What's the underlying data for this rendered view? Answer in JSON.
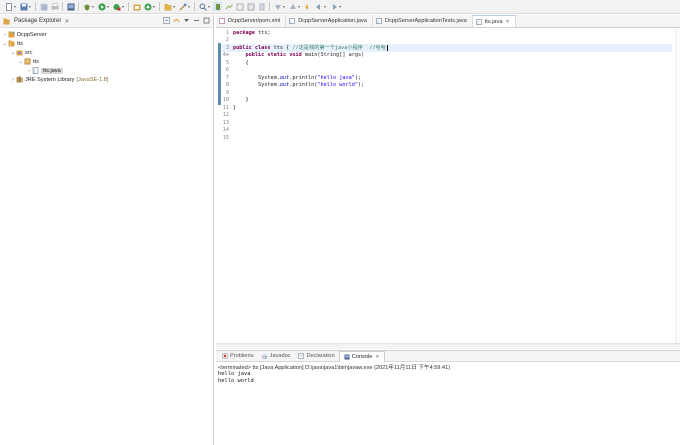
{
  "colors": {
    "keyword": "#7f0055",
    "string": "#2a00ff",
    "comment": "#3f7f5f",
    "field": "#0000c0",
    "current_line": "#e8f2fe",
    "change_bar": "#5f8fa8"
  },
  "toolbar": {
    "icons": [
      "new-icon",
      "save-icon",
      "save-all-icon",
      "print-icon",
      "terminal-icon",
      "debug-icon",
      "run-icon",
      "external-tools-icon",
      "new-java-project-icon",
      "new-package-icon",
      "new-class-icon",
      "open-type-icon",
      "search-icon",
      "next-annotation-icon",
      "previous-annotation-icon",
      "back-icon",
      "forward-icon"
    ]
  },
  "package_explorer": {
    "title": "Package Explorer",
    "close": "✕",
    "tree": {
      "project1": "DcppServer",
      "project2": "tts",
      "src": "src",
      "package": "tts",
      "file": "tts.java",
      "jre": "JRE System Library",
      "jre_version": "[JavaSE-1.8]"
    }
  },
  "editor": {
    "tabs": [
      {
        "label": "DcppServer/pom.xml",
        "close": ""
      },
      {
        "label": "DcppServerApplication.java",
        "close": ""
      },
      {
        "label": "DcppServerApplicationTests.java",
        "close": ""
      },
      {
        "label": "tts.java",
        "close": "✕"
      }
    ],
    "line_numbers": [
      "1",
      "2",
      "3",
      "4⊖",
      "5",
      "6",
      "7",
      "8",
      "9",
      "10",
      "11",
      "12",
      "13",
      "14",
      "15"
    ],
    "code": {
      "l1_kw": "package",
      "l1_rest": " tts;",
      "l3_kw1": "public",
      "l3_kw2": "class",
      "l3_rest": " tts { ",
      "l3_comment": "//这是我的第一个java小程序  //哈哈",
      "l4_kw1": "public",
      "l4_kw2": "static",
      "l4_kw3": "void",
      "l4_rest": " main(String[] args)",
      "l5": "{",
      "l7_a": "System.",
      "l7_field": "out",
      "l7_b": ".println(",
      "l7_str": "\"hello java\"",
      "l7_c": ");",
      "l8_a": "System.",
      "l8_field": "out",
      "l8_b": ".println(",
      "l8_str": "\"hello world\"",
      "l8_c": ");",
      "l10": "}",
      "l11": "}"
    }
  },
  "bottom_panel": {
    "tabs": [
      {
        "label": "Problems",
        "icon": "problems-icon"
      },
      {
        "label": "Javadoc",
        "icon": "javadoc-icon"
      },
      {
        "label": "Declaration",
        "icon": "declaration-icon"
      },
      {
        "label": "Console",
        "icon": "console-icon",
        "close": "✕"
      }
    ],
    "console": {
      "status": "<terminated> tts [Java Application] D:\\java\\java1\\bin\\javaw.exe (2021年11月11日 下午4:59:41)",
      "output": [
        "hello java",
        "hello world"
      ]
    }
  }
}
